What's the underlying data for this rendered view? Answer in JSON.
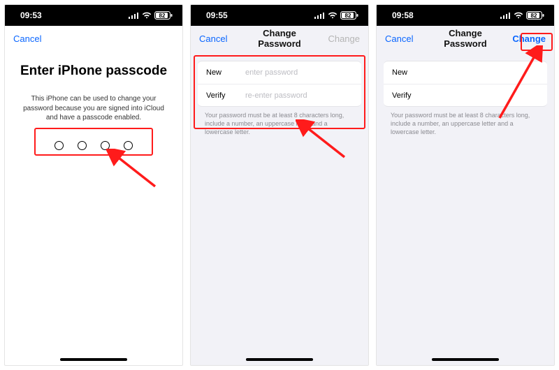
{
  "status": {
    "times": [
      "09:53",
      "09:55",
      "09:58"
    ],
    "battery": "82"
  },
  "nav": {
    "cancel": "Cancel",
    "title": "Change Password",
    "change": "Change"
  },
  "screen1": {
    "title": "Enter iPhone passcode",
    "desc": "This iPhone can be used to change your password because you are signed into iCloud and have a passcode enabled."
  },
  "form": {
    "new_label": "New",
    "verify_label": "Verify",
    "new_placeholder": "enter password",
    "verify_placeholder": "re-enter password",
    "hint": "Your password must be at least 8 characters long, include a number, an uppercase letter and a lowercase letter."
  }
}
